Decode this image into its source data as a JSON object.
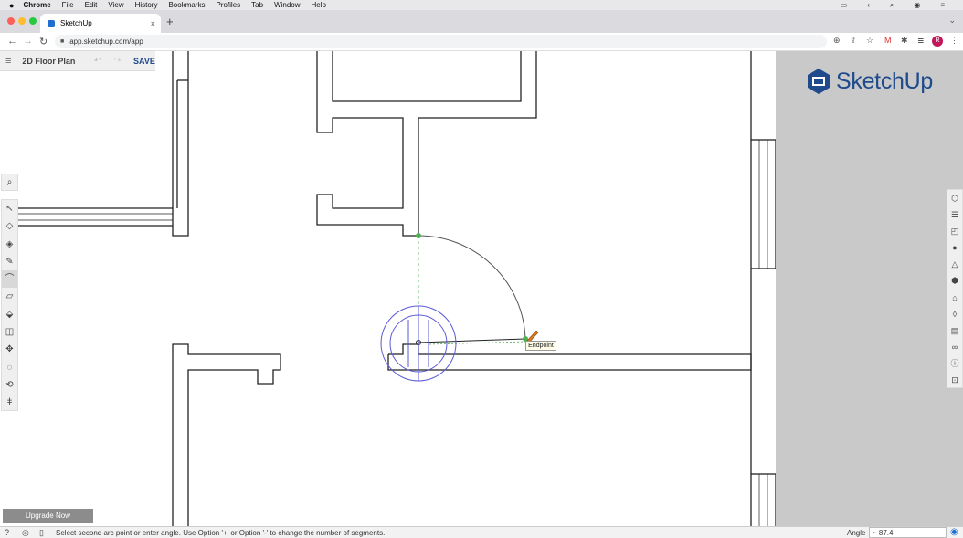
{
  "mac_menu": {
    "apple": "",
    "app": "Chrome",
    "items": [
      "File",
      "Edit",
      "View",
      "History",
      "Bookmarks",
      "Profiles",
      "Tab",
      "Window",
      "Help"
    ]
  },
  "browser": {
    "tab_title": "SketchUp",
    "close": "×",
    "new_tab": "+",
    "url": "app.sketchup.com/app",
    "avatar_letter": "R"
  },
  "app": {
    "menu_icon": "hamburger-icon",
    "title": "2D Floor Plan",
    "undo": "↶",
    "redo": "↷",
    "save": "SAVE",
    "logo_text": "SketchUp",
    "brand_color": "#1f4a8c",
    "upgrade": "Upgrade Now",
    "tooltip": "Endpoint",
    "status_message": "Select second arc point or enter angle. Use Option '+' or Option '-' to change the number of segments.",
    "angle_label": "Angle",
    "angle_value": "~ 87.4"
  },
  "tools": {
    "search": "search-icon",
    "left": [
      "select-icon",
      "eraser-icon",
      "paint-bucket-icon",
      "pencil-icon",
      "arc-icon",
      "rectangle-icon",
      "push-pull-icon",
      "offset-icon",
      "move-icon",
      "tape-measure-icon",
      "orbit-icon",
      "walk-icon"
    ],
    "right": [
      "entity-info-icon",
      "outliner-icon",
      "materials-icon",
      "components-icon",
      "styles-icon",
      "scenes-icon",
      "solid-tools-icon",
      "tags-icon",
      "display-icon",
      "glasses-icon",
      "info-icon",
      "export-icon"
    ]
  }
}
